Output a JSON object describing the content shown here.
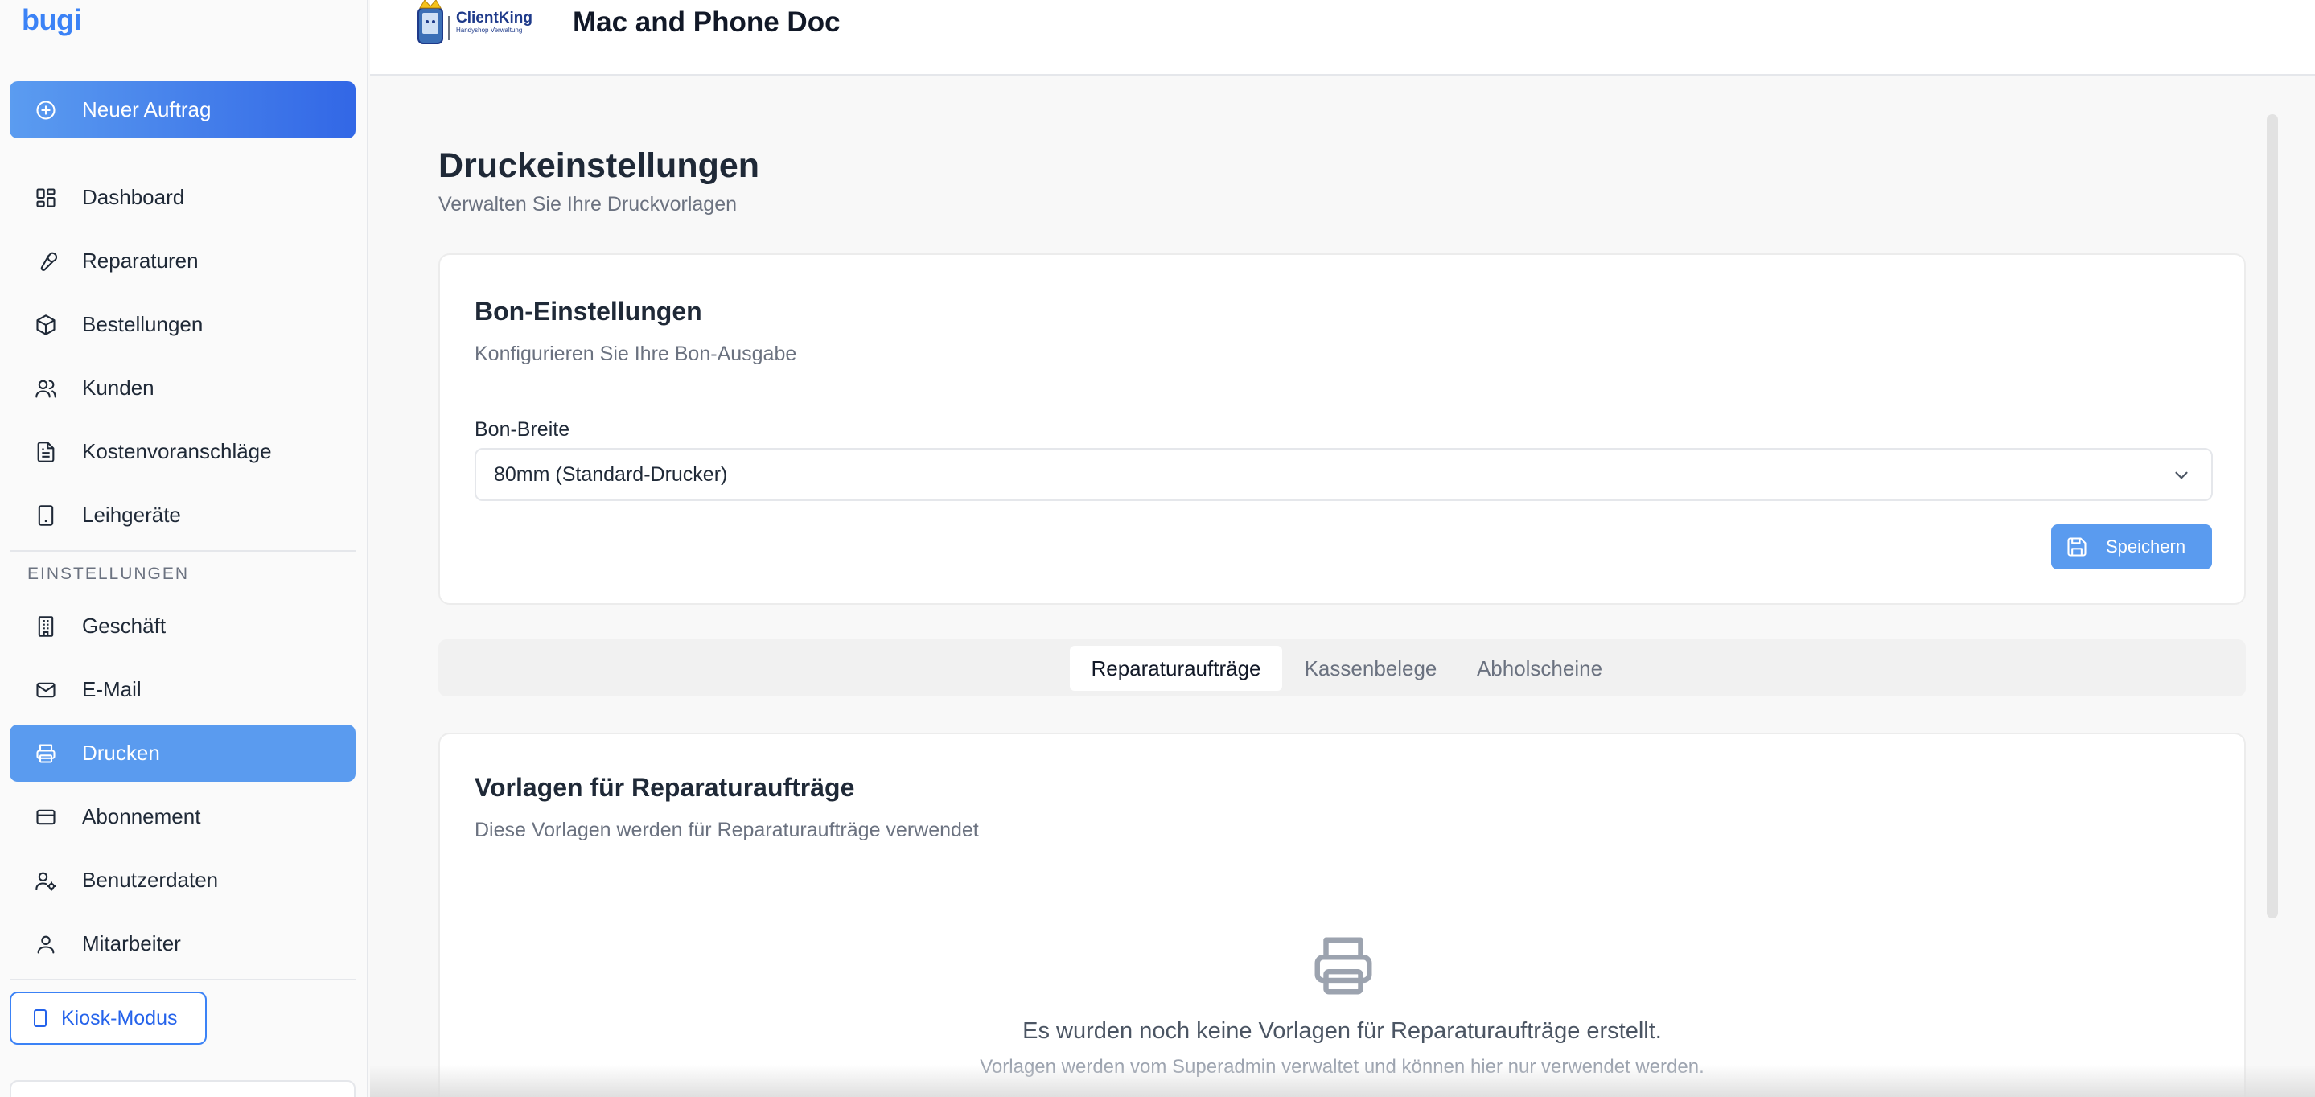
{
  "app": {
    "brand": "bugi"
  },
  "sidebar": {
    "new_order_label": "Neuer Auftrag",
    "items": [
      {
        "label": "Dashboard",
        "icon": "dashboard-icon"
      },
      {
        "label": "Reparaturen",
        "icon": "wrench-icon"
      },
      {
        "label": "Bestellungen",
        "icon": "package-icon"
      },
      {
        "label": "Kunden",
        "icon": "users-icon"
      },
      {
        "label": "Kostenvoranschläge",
        "icon": "file-text-icon"
      },
      {
        "label": "Leihgeräte",
        "icon": "tablet-icon"
      }
    ],
    "settings_section_label": "EINSTELLUNGEN",
    "settings_items": [
      {
        "label": "Geschäft",
        "icon": "building-icon"
      },
      {
        "label": "E-Mail",
        "icon": "mail-icon"
      },
      {
        "label": "Drucken",
        "icon": "printer-icon",
        "active": true
      },
      {
        "label": "Abonnement",
        "icon": "credit-card-icon"
      },
      {
        "label": "Benutzerdaten",
        "icon": "user-cog-icon"
      },
      {
        "label": "Mitarbeiter",
        "icon": "user-icon"
      }
    ],
    "kiosk_label": "Kiosk-Modus"
  },
  "header": {
    "logo_text": "ClientKing",
    "logo_subtext": "Handyshop Verwaltung",
    "shop_name": "Mac and Phone Doc"
  },
  "page": {
    "title": "Druckeinstellungen",
    "subtitle": "Verwalten Sie Ihre Druckvorlagen"
  },
  "receipt_settings": {
    "title": "Bon-Einstellungen",
    "description": "Konfigurieren Sie Ihre Bon-Ausgabe",
    "width_label": "Bon-Breite",
    "width_value": "80mm (Standard-Drucker)",
    "save_label": "Speichern"
  },
  "tabs": [
    {
      "label": "Reparaturaufträge",
      "active": true
    },
    {
      "label": "Kassenbelege",
      "active": false
    },
    {
      "label": "Abholscheine",
      "active": false
    }
  ],
  "templates": {
    "title": "Vorlagen für Reparaturaufträge",
    "description": "Diese Vorlagen werden für Reparaturaufträge verwendet",
    "empty_title": "Es wurden noch keine Vorlagen für Reparaturaufträge erstellt.",
    "empty_subtitle": "Vorlagen werden vom Superadmin verwaltet und können hier nur verwendet werden."
  },
  "colors": {
    "accent": "#3b82f6",
    "active_nav": "#5a9bef",
    "text": "#1f2937",
    "muted": "#6b7280"
  }
}
